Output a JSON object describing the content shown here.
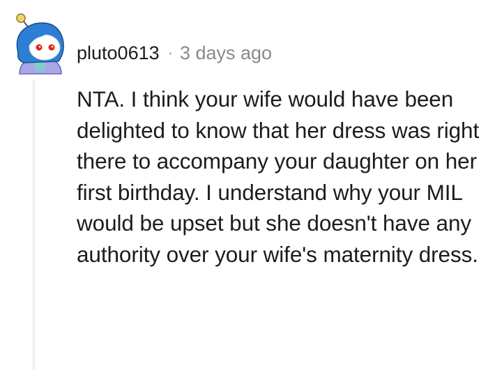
{
  "comment": {
    "author": "pluto0613",
    "separator": "·",
    "timestamp": "3 days ago",
    "body": "NTA. I think your wife would have been delighted to know that her dress was right there to accompany your daughter on her first birthday. I understand why your MIL would be upset but she doesn't have any authority over your wife's maternity dress.",
    "avatar_icon": "snoo-avatar-icon"
  },
  "colors": {
    "text": "#1c1c1c",
    "meta": "#878a8c",
    "thread_line": "#edeff1",
    "avatar_hair": "#2d7fd6",
    "avatar_eyes": "#e0261a"
  }
}
